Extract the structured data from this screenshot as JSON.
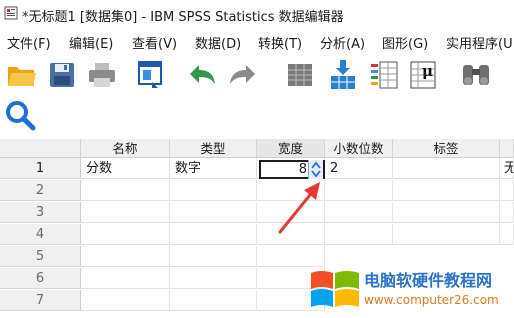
{
  "window": {
    "title": "*无标题1 [数据集0] - IBM SPSS Statistics 数据编辑器"
  },
  "menu": [
    {
      "label": "文件(F)"
    },
    {
      "label": "编辑(E)"
    },
    {
      "label": "查看(V)"
    },
    {
      "label": "数据(D)"
    },
    {
      "label": "转换(T)"
    },
    {
      "label": "分析(A)"
    },
    {
      "label": "图形(G)"
    },
    {
      "label": "实用程序(U"
    }
  ],
  "toolbar": {
    "icons": [
      "open-folder-icon",
      "save-icon",
      "print-icon",
      "dialog-recall-icon",
      "undo-icon",
      "redo-icon",
      "goto-case-icon",
      "goto-variable-icon",
      "variables-icon",
      "descriptive-statistics-icon",
      "find-binoculars-icon",
      "search-icon"
    ]
  },
  "grid": {
    "columns": [
      "名称",
      "类型",
      "宽度",
      "小数位数",
      "标签"
    ],
    "rows": [
      {
        "num": "1",
        "name": "分数",
        "type": "数字",
        "width": "8",
        "decimals": "2",
        "label": "",
        "extra": "无"
      },
      {
        "num": "2"
      },
      {
        "num": "3"
      },
      {
        "num": "4"
      },
      {
        "num": "5"
      },
      {
        "num": "6"
      },
      {
        "num": "7"
      }
    ]
  },
  "watermark": {
    "title": "电脑软硬件教程网",
    "url": "www.computer26.com"
  },
  "colors": {
    "arrow": "#e53935",
    "spin_accent": "#1e6fd9",
    "watermark_title": "#2a73c9",
    "watermark_url": "#e07a1e"
  }
}
